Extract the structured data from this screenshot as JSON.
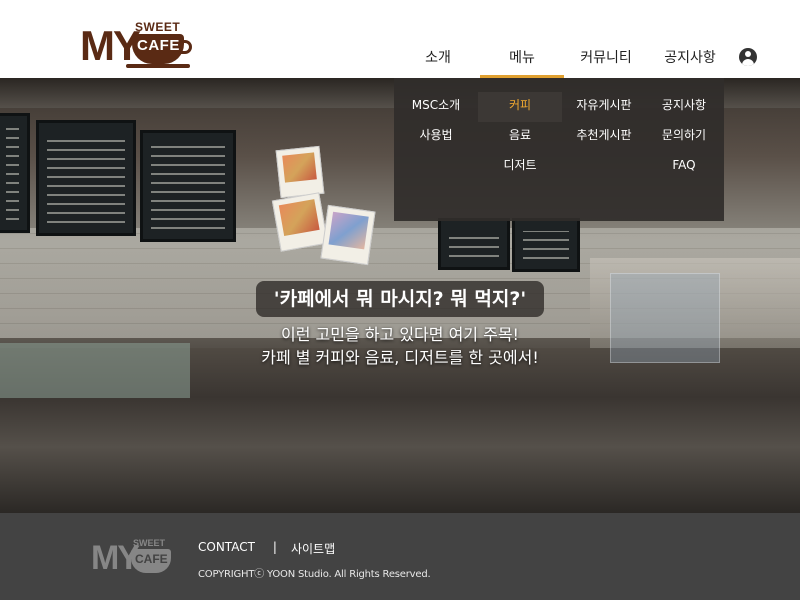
{
  "logo": {
    "top": "MY",
    "sweet": "SWEET",
    "cafe": "CAFE"
  },
  "nav": {
    "items": [
      {
        "label": "소개",
        "active": false
      },
      {
        "label": "메뉴",
        "active": true
      },
      {
        "label": "커뮤니티",
        "active": false
      },
      {
        "label": "공지사항",
        "active": false
      }
    ],
    "user_icon": "user-circle-icon",
    "accent_color": "#e0a030"
  },
  "dropdown": {
    "columns": [
      [
        "MSC소개",
        "사용법"
      ],
      [
        "커피",
        "음료",
        "디저트"
      ],
      [
        "자유게시판",
        "추천게시판"
      ],
      [
        "공지사항",
        "문의하기",
        "FAQ"
      ]
    ],
    "active_item": "커피",
    "active_color": "#f0a830"
  },
  "hero": {
    "title": "'카페에서 뭐 마시지? 뭐 먹지?'",
    "line1": "이런 고민을 하고 있다면 여기 주목!",
    "line2": "카페 별 커피와 음료, 디저트를 한 곳에서!"
  },
  "footer": {
    "contact": "CONTACT",
    "separator": "|",
    "sitemap": "사이트맵",
    "copyright": "COPYRIGHTⓒ YOON Studio. All Rights Reserved.",
    "background": "#434343"
  }
}
